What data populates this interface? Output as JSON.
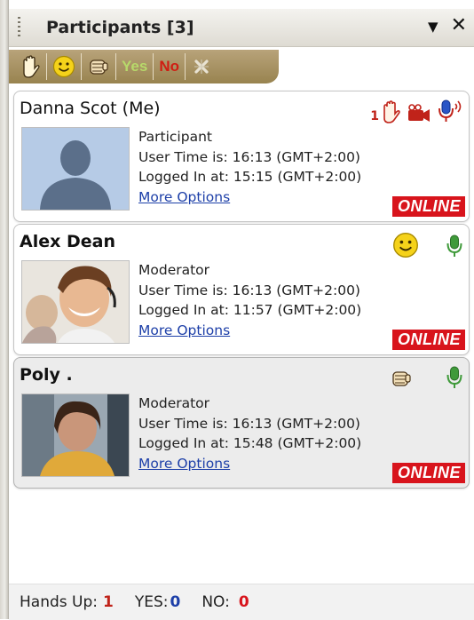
{
  "panel": {
    "title": "Participants [3]"
  },
  "toolbar": {
    "yes_label": "Yes",
    "no_label": "No"
  },
  "participants": [
    {
      "name": "Danna Scot (Me)",
      "role": "Participant",
      "user_time": "User Time is: 16:13 (GMT+2:00)",
      "logged_in": "Logged In at: 15:15 (GMT+2:00)",
      "more_options": "More Options",
      "status": "ONLINE",
      "hand_count": "1"
    },
    {
      "name": "Alex Dean",
      "role": "Moderator",
      "user_time": "User Time is: 16:13 (GMT+2:00)",
      "logged_in": "Logged In at: 11:57 (GMT+2:00)",
      "more_options": "More Options",
      "status": "ONLINE"
    },
    {
      "name": "Poly .",
      "role": "Moderator",
      "user_time": "User Time is: 16:13 (GMT+2:00)",
      "logged_in": "Logged In at: 15:48 (GMT+2:00)",
      "more_options": "More Options",
      "status": "ONLINE"
    }
  ],
  "footer": {
    "hands_up_label": "Hands Up:",
    "hands_up_value": "1",
    "yes_label": "YES:",
    "yes_value": "0",
    "no_label": "NO:",
    "no_value": "0"
  },
  "colors": {
    "online_badge": "#d8141c",
    "link": "#1d3fa8",
    "hands_up_value": "#c0231a",
    "yes_value": "#1d3fa8",
    "no_value": "#d8141c",
    "toolbar": "#a8925f",
    "mic_active_red": "#c0231a",
    "mic_green": "#3f9a3a"
  }
}
